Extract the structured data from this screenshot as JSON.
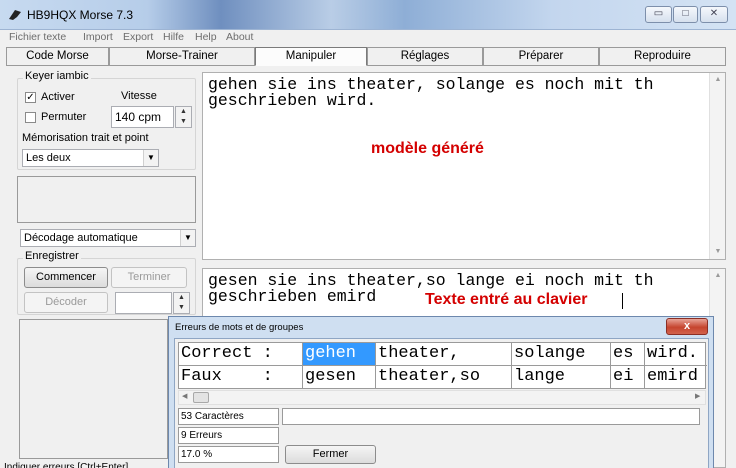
{
  "window": {
    "title": "HB9HQX Morse 7.3"
  },
  "menu": [
    "Fichier texte",
    "Import",
    "Export",
    "Hilfe",
    "Help",
    "About"
  ],
  "modes": [
    "Code Morse",
    "Morse-Trainer",
    "Manipuler",
    "Réglages",
    "Préparer",
    "Reproduire"
  ],
  "active_mode": "Manipuler",
  "keyer": {
    "group_title": "Keyer iambic",
    "activer_label": "Activer",
    "activer_checked": true,
    "permuter_label": "Permuter",
    "permuter_checked": false,
    "vitesse_label": "Vitesse",
    "vitesse_value": "140 cpm",
    "memo_label": "Mémorisation trait et point",
    "memo_value": "Les deux"
  },
  "decode_mode": "Décodage automatique",
  "record": {
    "group_title": "Enregistrer",
    "start_label": "Commencer",
    "stop_label": "Terminer",
    "decode_label": "Décoder"
  },
  "generated": {
    "line1": "gehen sie ins theater, solange es noch mit th",
    "line2": "geschrieben wird.",
    "annotation": "modèle généré"
  },
  "typed": {
    "line1": "gesen sie ins theater,so lange ei noch mit th",
    "line2": "geschrieben emird",
    "annotation": "Texte entré au clavier"
  },
  "dialog": {
    "title": "Erreurs de mots et de groupes",
    "close_label": "x",
    "rows": [
      [
        "Correct :",
        "gehen",
        "theater,",
        "solange",
        "es",
        "wird."
      ],
      [
        "Faux    :",
        "gesen",
        "theater,so",
        "lange",
        "ei",
        "emird"
      ]
    ],
    "selected_cell": [
      0,
      1
    ],
    "characters": "53 Caractères",
    "errors": "9 Erreurs",
    "percent": "17.0 %",
    "close_button": "Fermer"
  },
  "status": "Indiquer erreurs   [Ctrl+Enter]",
  "icons": [
    "app-icon",
    "minimize-icon",
    "maximize-icon",
    "close-icon"
  ]
}
